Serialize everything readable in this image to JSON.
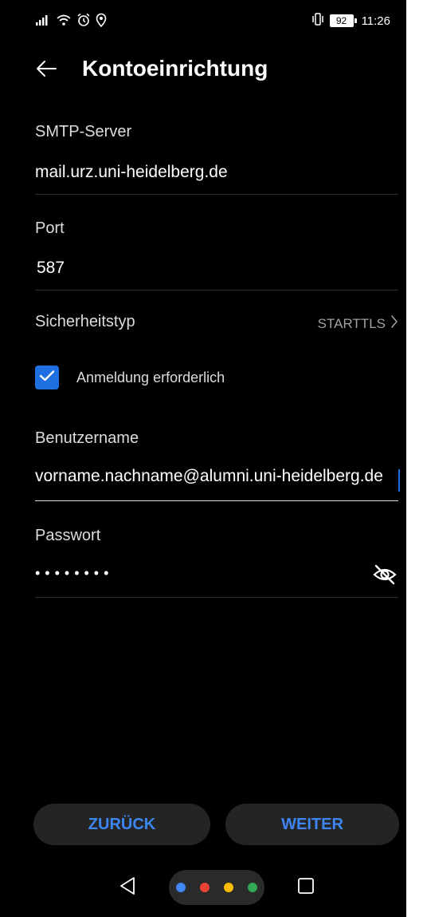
{
  "status_bar": {
    "icons": [
      "signal-icon",
      "wifi-icon",
      "alarm-icon",
      "location-icon",
      "vibrate-icon"
    ],
    "battery": "92",
    "time": "11:26"
  },
  "header": {
    "back_icon": "arrow-left-icon",
    "title": "Kontoeinrichtung"
  },
  "form": {
    "smtp_server": {
      "label": "SMTP-Server",
      "value": "mail.urz.uni-heidelberg.de"
    },
    "port": {
      "label": "Port",
      "value": "587"
    },
    "security": {
      "label": "Sicherheitstyp",
      "value": "STARTTLS"
    },
    "auth_required": {
      "label": "Anmeldung erforderlich",
      "checked": true
    },
    "username": {
      "label": "Benutzername",
      "value": "vorname.nachname@alumni.uni-heidelberg.de"
    },
    "password": {
      "label": "Passwort",
      "value": "••••••••"
    }
  },
  "buttons": {
    "back_label": "ZURÜCK",
    "next_label": "WEITER"
  },
  "nav_bar": {
    "icons": [
      "nav-back-icon",
      "nav-home-icon",
      "nav-recents-icon"
    ]
  },
  "colors": {
    "background": "#000000",
    "accent": "#1e6fe0",
    "button_text": "#3d86f1",
    "button_bg": "#242424",
    "google_blue": "#4285f4",
    "google_red": "#ea4335",
    "google_yellow": "#fbbc05",
    "google_green": "#34a853"
  }
}
